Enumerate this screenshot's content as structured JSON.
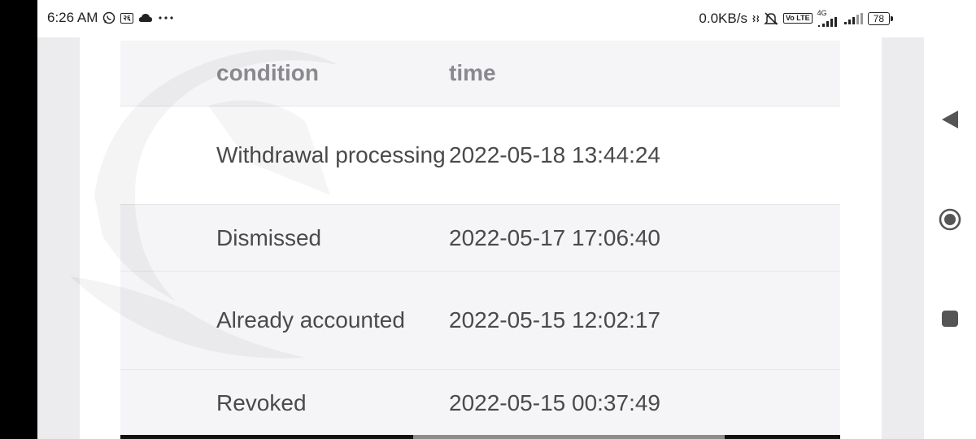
{
  "status_bar": {
    "time": "6:26 AM",
    "network_speed": "0.0KB/s",
    "network_type": "4G",
    "volte_label": "Vo LTE",
    "battery_level": "78",
    "icons": [
      "whatsapp-icon",
      "app-badge-icon",
      "cloud-icon",
      "more-dots-icon",
      "vibrate-icon",
      "mute-icon",
      "volte-icon",
      "signal-icon",
      "signal-2-icon",
      "battery-icon"
    ]
  },
  "table": {
    "headers": {
      "condition": "condition",
      "time": "time"
    },
    "rows": [
      {
        "condition": "Withdrawal processing",
        "time": "2022-05-18 13:44:24"
      },
      {
        "condition": "Dismissed",
        "time": "2022-05-17 17:06:40"
      },
      {
        "condition": "Already accounted",
        "time": "2022-05-15 12:02:17"
      },
      {
        "condition": "Revoked",
        "time": "2022-05-15 00:37:49"
      }
    ]
  },
  "nav_bar": {
    "icons": [
      "back-triangle-icon",
      "home-circle-icon",
      "recents-square-icon"
    ]
  },
  "colors": {
    "header_bg": "#f5f5f8",
    "row_text": "#4a4a4a",
    "header_text": "#8a8a8e",
    "page_bg": "#ececef"
  }
}
